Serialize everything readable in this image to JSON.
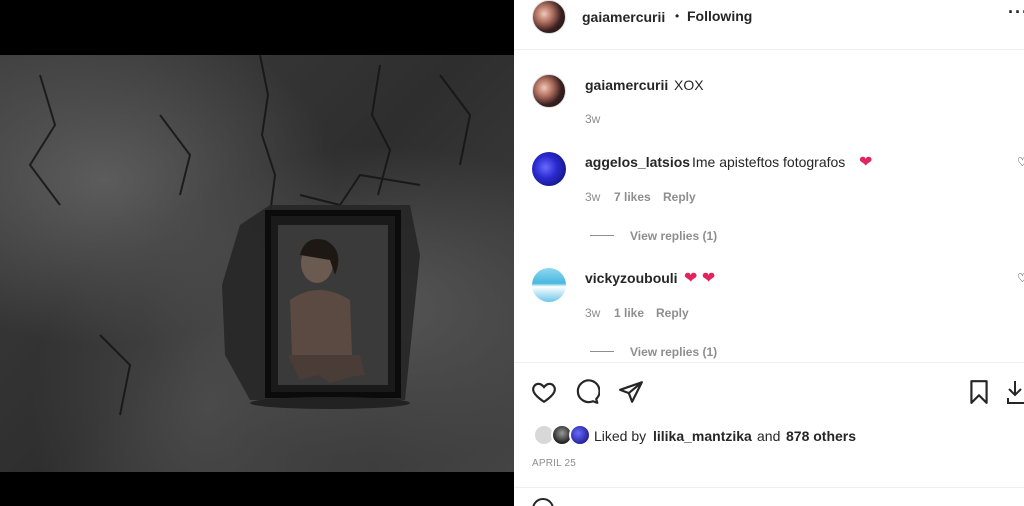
{
  "post": {
    "author": "gaiamercurii",
    "follow_status": "Following",
    "separator": "•",
    "caption_user": "gaiamercurii",
    "caption_text": "XOX",
    "caption_age": "3w",
    "more_icon": "more-horizontal-icon"
  },
  "comments": [
    {
      "user": "aggelos_latsios",
      "text": "Ime apisteftos fotografos",
      "emoji": "❤",
      "age": "3w",
      "likes": "7 likes",
      "reply": "Reply",
      "view_replies": "View replies (1)"
    },
    {
      "user": "vickyzoubouli",
      "text": "",
      "emoji": "❤ ❤",
      "age": "3w",
      "likes": "1 like",
      "reply": "Reply",
      "view_replies": "View replies (1)"
    }
  ],
  "actions": {
    "icons": [
      "heart-icon",
      "comment-icon",
      "share-icon",
      "bookmark-icon",
      "download-icon"
    ],
    "liked_by_prefix": "Liked by",
    "liked_by_user": "lilika_mantzika",
    "liked_by_and": "and",
    "liked_by_others": "878 others",
    "date": "APRIL 25"
  },
  "colors": {
    "heart": "#e0245e",
    "text": "#262626",
    "muted": "#8e8e8e",
    "divider": "#efefef"
  }
}
